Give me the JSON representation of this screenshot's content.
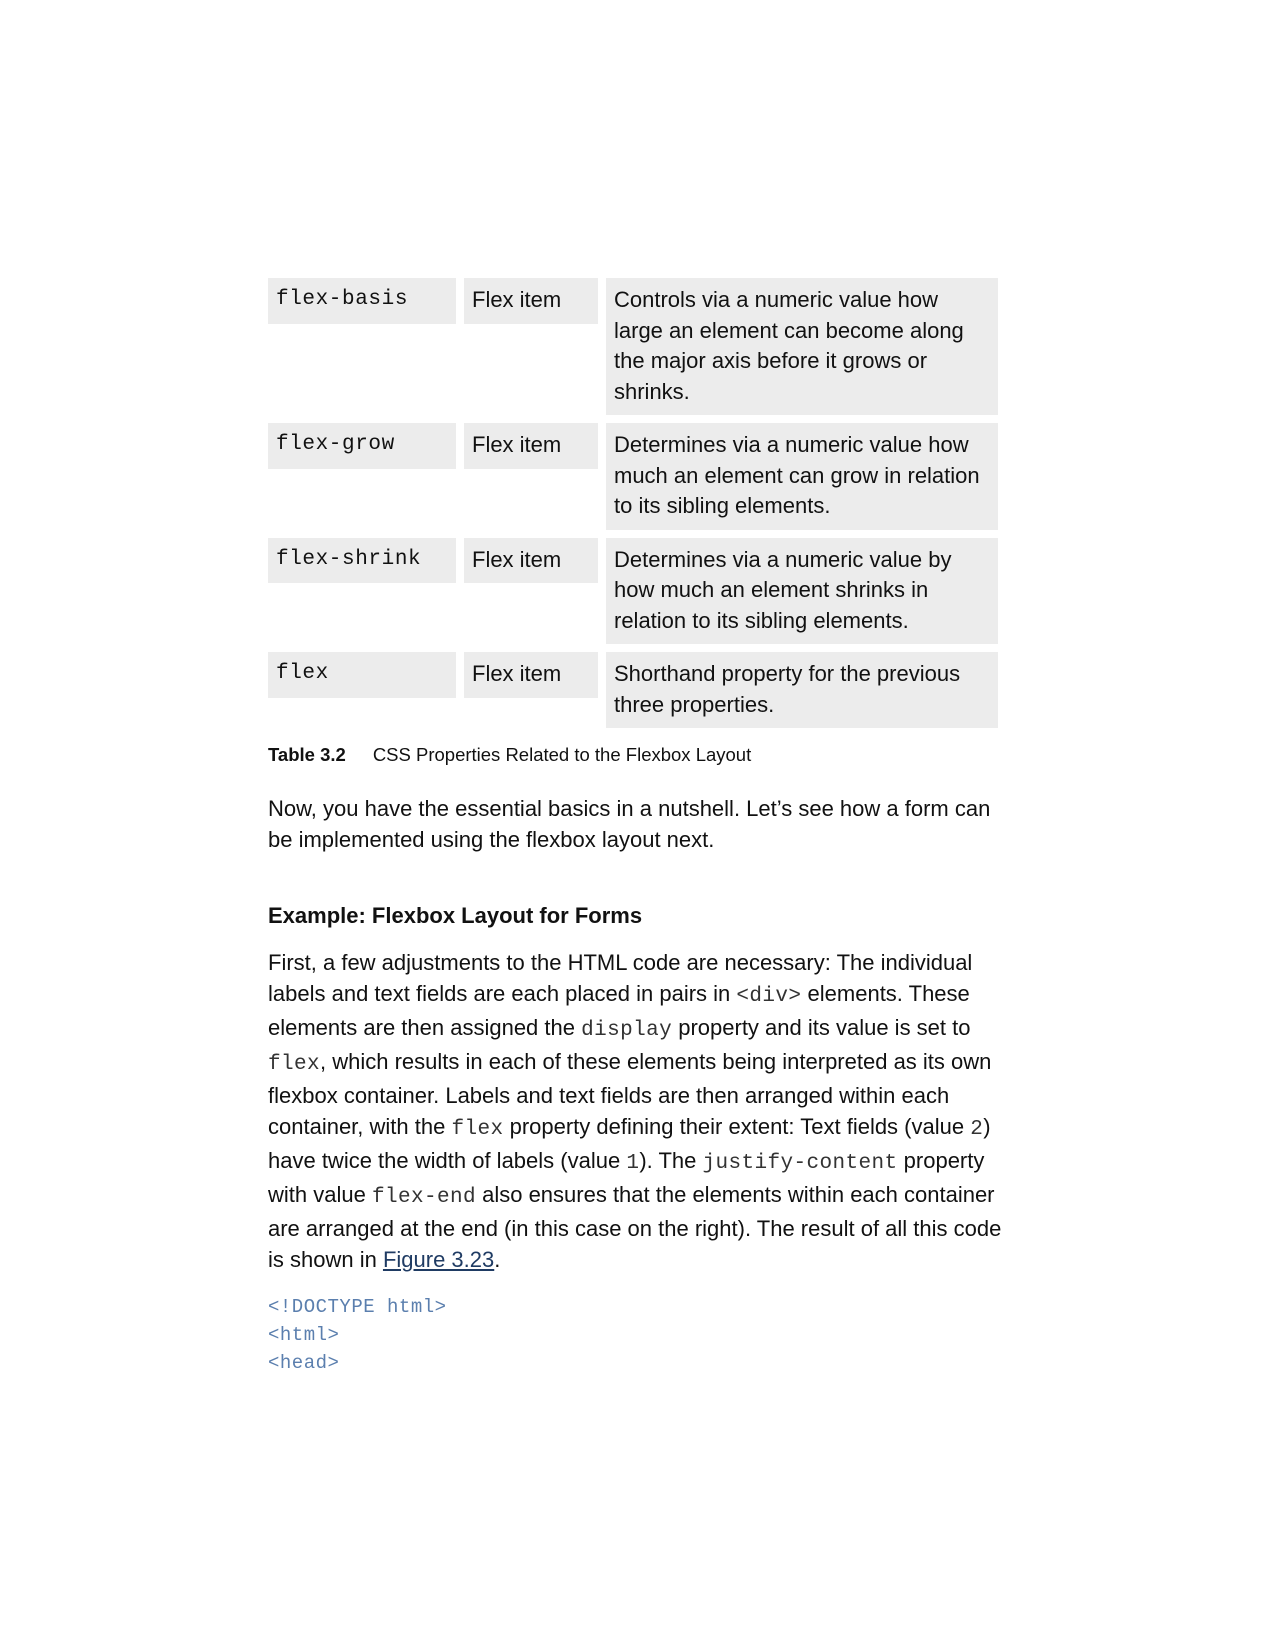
{
  "table": {
    "rows": [
      {
        "property": "flex-basis",
        "applies_to": "Flex item",
        "description": "Controls via a numeric value how large an element can become along the major axis before it grows or shrinks."
      },
      {
        "property": "flex-grow",
        "applies_to": "Flex item",
        "description": "Determines via a numeric value how much an element can grow in relation to its sibling elements."
      },
      {
        "property": "flex-shrink",
        "applies_to": "Flex item",
        "description": "Determines via a numeric value by how much an element shrinks in relation to its sibling elements."
      },
      {
        "property": "flex",
        "applies_to": "Flex item",
        "description": "Shorthand property for the previous three properties."
      }
    ]
  },
  "caption": {
    "label": "Table 3.2",
    "text": "CSS Properties Related to the Flexbox Layout"
  },
  "intro_paragraph": "Now, you have the essential basics in a nutshell. Let’s see how a form can be implemented using the flexbox layout next.",
  "section": {
    "heading": "Example: Flexbox Layout for Forms",
    "p": {
      "t1": "First, a few adjustments to the HTML code are necessary: The individual labels and text fields are each placed in pairs in ",
      "c1": "<div>",
      "t2": " elements. These elements are then assigned the ",
      "c2": "display",
      "t3": " property and its value is set to ",
      "c3": "flex",
      "t4": ", which results in each of these elements being interpreted as its own flexbox container. Labels and text fields are then arranged within each container, with the ",
      "c4": "flex",
      "t5": " property defining their extent: Text fields (value ",
      "c5": "2",
      "t6": ") have twice the width of labels (value ",
      "c6": "1",
      "t7": "). The ",
      "c7": "justify-content",
      "t8": " property with value ",
      "c8": "flex-end",
      "t9": " also ensures that the elements within each container are arranged at the end (in this case on the right). The result of all this code is shown in ",
      "link": "Figure 3.23",
      "t10": "."
    }
  },
  "code_block": {
    "lines": [
      "<!DOCTYPE html>",
      "<html>",
      "<head>"
    ]
  }
}
